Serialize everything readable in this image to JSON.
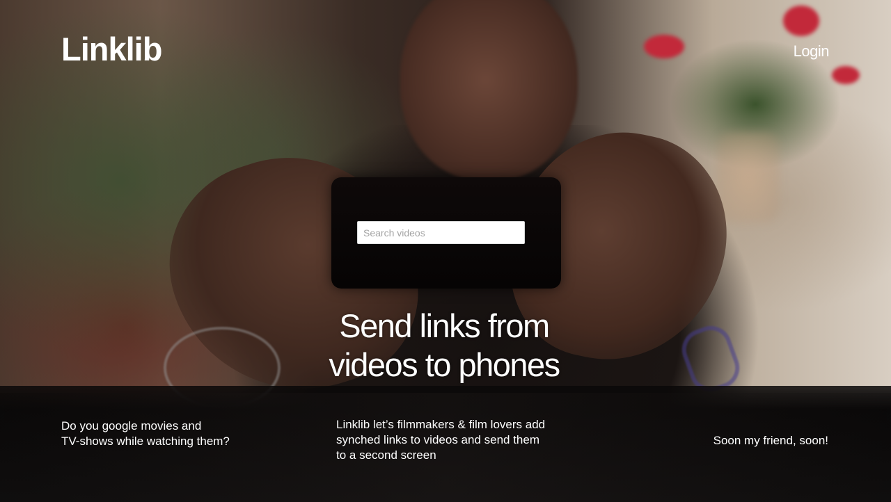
{
  "brand": {
    "logo": "Linklib"
  },
  "nav": {
    "login_label": "Login"
  },
  "search": {
    "placeholder": "Search videos",
    "value": ""
  },
  "hero": {
    "headline": "Send links from\nvideos to phones"
  },
  "features": {
    "left": "Do you google movies and\nTV-shows while watching them?",
    "center": "Linklib let’s filmmakers & film lovers add\nsynched links to videos and send them\nto a second screen",
    "right": "Soon my friend, soon!"
  },
  "colors": {
    "text": "#ffffff",
    "search_background": "#ffffff",
    "search_placeholder": "#a4a4a4"
  }
}
